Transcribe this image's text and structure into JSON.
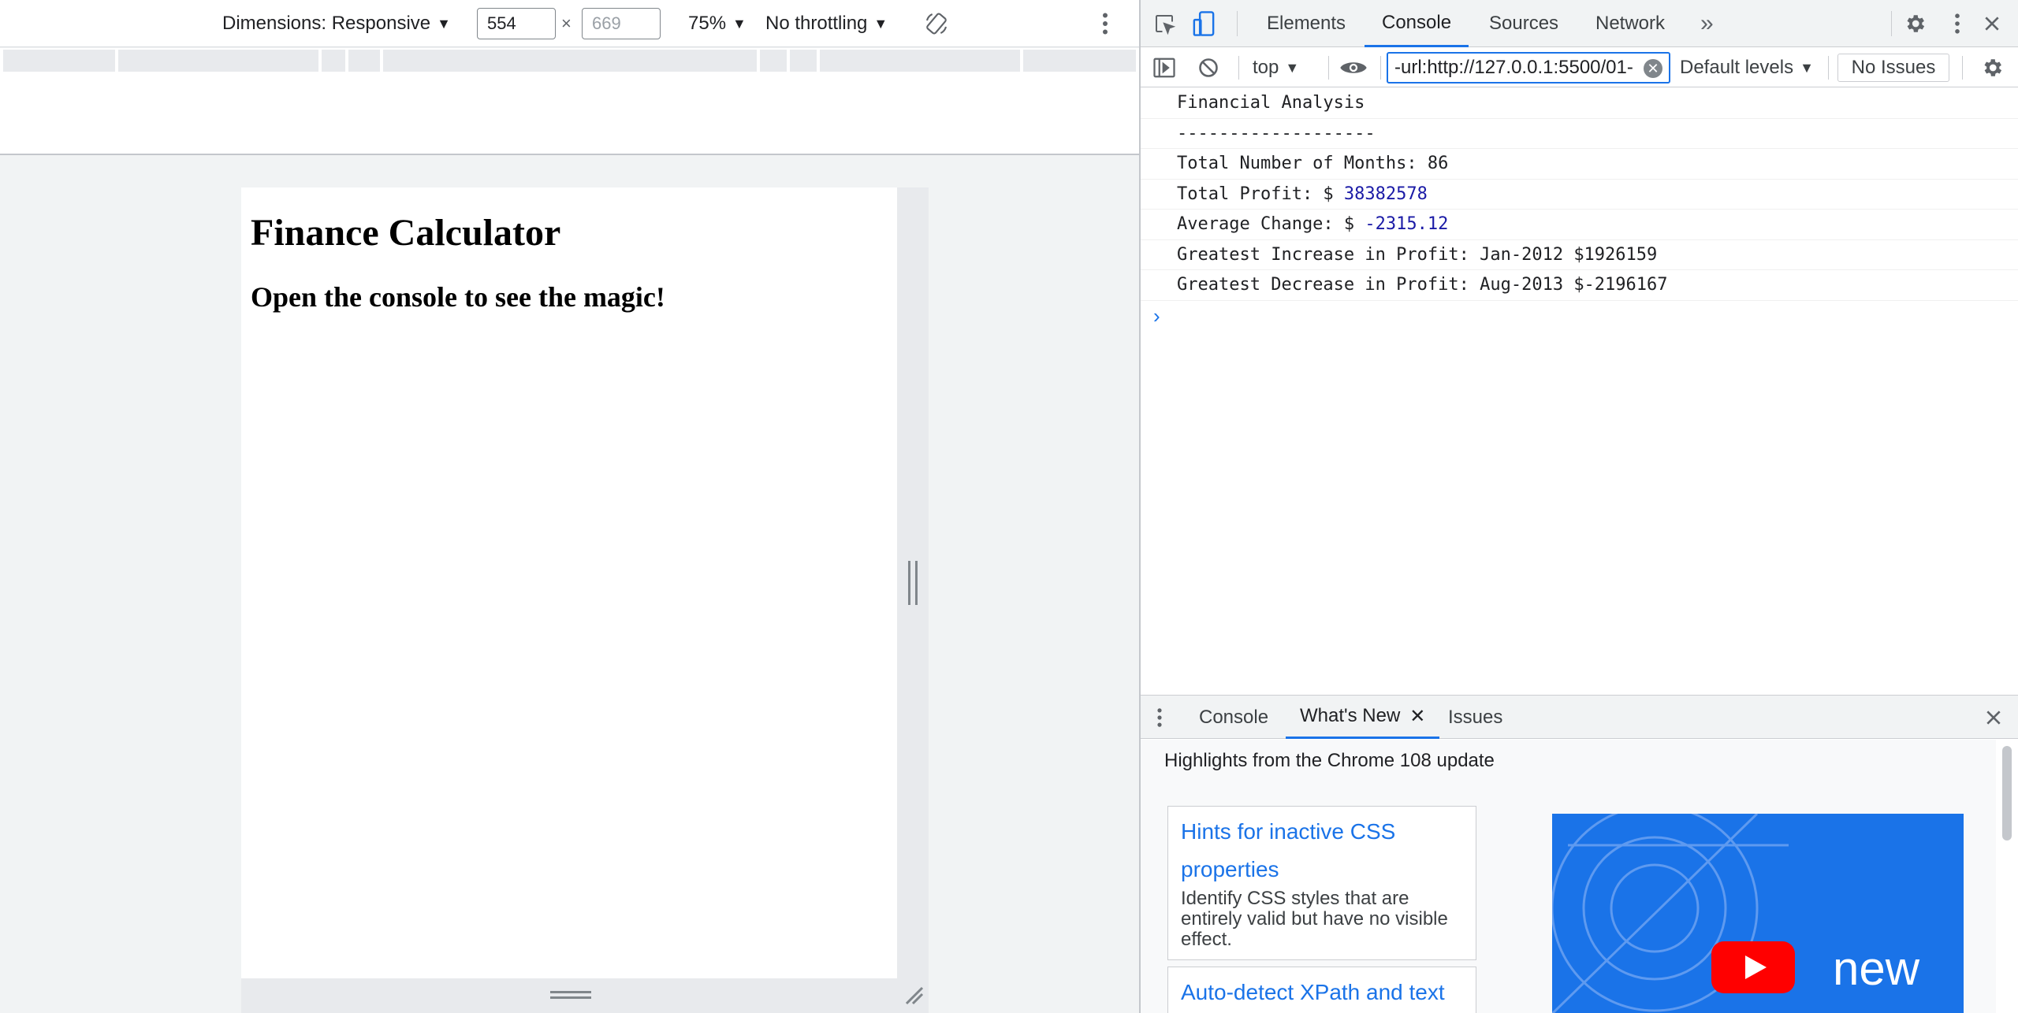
{
  "device_toolbar": {
    "dimensions_label": "Dimensions: Responsive",
    "width_value": "554",
    "height_placeholder": "669",
    "times": "×",
    "zoom": "75%",
    "throttling": "No throttling"
  },
  "page": {
    "heading": "Finance Calculator",
    "subheading": "Open the console to see the magic!"
  },
  "devtools": {
    "tabs": [
      "Elements",
      "Console",
      "Sources",
      "Network"
    ],
    "active_tab": "Console",
    "more_tabs": "»",
    "console_toolbar": {
      "context": "top",
      "filter_value": "-url:http://127.0.0.1:5500/01-",
      "levels": "Default levels",
      "issues": "No Issues"
    },
    "console_lines": {
      "l1": "Financial Analysis",
      "l2": "-------------------",
      "l3": "Total Number of Months: 86",
      "l4_prefix": "Total Profit: $ ",
      "l4_num": "38382578",
      "l5_prefix": "Average Change: $ ",
      "l5_num": "-2315.12",
      "l6": "Greatest Increase in Profit: Jan-2012 $1926159",
      "l7": "Greatest Decrease in Profit: Aug-2013 $-2196167",
      "prompt": "›"
    },
    "drawer": {
      "tabs": {
        "console": "Console",
        "whats_new": "What's New",
        "issues": "Issues"
      },
      "header": "Highlights from the Chrome 108 update",
      "cards": [
        {
          "title": "Hints for inactive CSS properties",
          "desc": "Identify CSS styles that are entirely valid but have no visible effect."
        },
        {
          "title": "Auto-detect XPath and text",
          "desc": ""
        }
      ],
      "video_caption": "new"
    }
  },
  "colors": {
    "accent": "#1a73e8",
    "console_number": "#1a1aa6",
    "youtube_red": "#ff0000"
  },
  "icons": [
    "more-vert-icon",
    "rotate-icon",
    "inspect-icon",
    "device-icon",
    "gear-icon",
    "close-icon",
    "sidebar-icon",
    "clear-console-icon",
    "eye-icon"
  ]
}
